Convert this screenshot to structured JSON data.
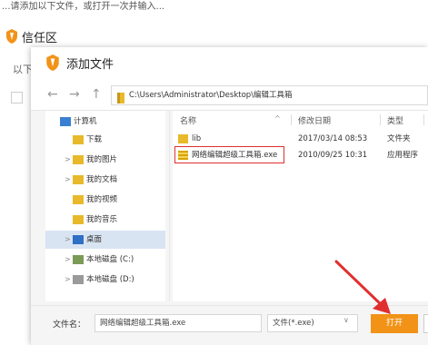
{
  "top_strip": {
    "text": "...请添加以下文件，或打开一次并输入..."
  },
  "background_app": {
    "title": "信任区",
    "left_text": "以下"
  },
  "dialog": {
    "title": "添加文件",
    "nav": {
      "back": "←",
      "forward": "→",
      "up": "↑"
    },
    "address_path": "C:\\Users\\Administrator\\Desktop\\编辑工具箱",
    "tree": [
      {
        "label": "计算机",
        "icon": "computer-icon",
        "indent": 0,
        "expand": ""
      },
      {
        "label": "下载",
        "icon": "folder-download-icon",
        "indent": 1,
        "expand": ""
      },
      {
        "label": "我的图片",
        "icon": "folder-pictures-icon",
        "indent": 1,
        "expand": ">"
      },
      {
        "label": "我的文档",
        "icon": "folder-documents-icon",
        "indent": 1,
        "expand": ">"
      },
      {
        "label": "我的视频",
        "icon": "folder-videos-icon",
        "indent": 1,
        "expand": ""
      },
      {
        "label": "我的音乐",
        "icon": "folder-music-icon",
        "indent": 1,
        "expand": ""
      },
      {
        "label": "桌面",
        "icon": "desktop-icon",
        "indent": 1,
        "expand": ">"
      },
      {
        "label": "本地磁盘 (C:)",
        "icon": "drive-c-icon",
        "indent": 1,
        "expand": ">"
      },
      {
        "label": "本地磁盘 (D:)",
        "icon": "drive-d-icon",
        "indent": 1,
        "expand": ">"
      }
    ],
    "selected_tree_index": 6,
    "columns": {
      "name": "名称",
      "modified": "修改日期",
      "type": "类型"
    },
    "files": [
      {
        "name": "lib",
        "modified": "2017/03/14 08:53",
        "type": "文件夹",
        "icon": "folder-icon"
      },
      {
        "name": "网络编辑超级工具箱.exe",
        "modified": "2010/09/25 10:31",
        "type": "应用程序",
        "icon": "exe-icon"
      }
    ],
    "filename_label": "文件名：",
    "filename_value": "网络编辑超级工具箱.exe",
    "filetype_value": "文件(*.exe)",
    "open_label": "打开"
  },
  "colors": {
    "accent_orange": "#f29318",
    "highlight_red": "#e02f2f",
    "tree_selected": "#d9e4f2"
  }
}
